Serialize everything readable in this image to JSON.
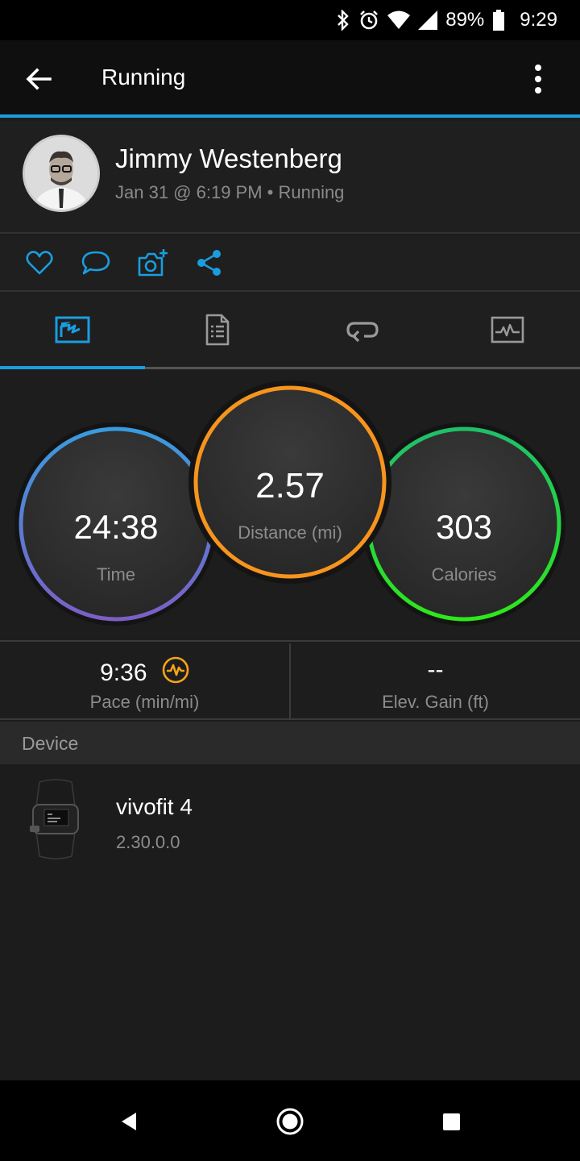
{
  "status_bar": {
    "battery": "89%",
    "time": "9:29",
    "icons": [
      "bluetooth-icon",
      "alarm-icon",
      "wifi-icon",
      "signal-icon",
      "battery-icon"
    ]
  },
  "app_bar": {
    "title": "Running",
    "back_icon": "back-arrow-icon",
    "menu_icon": "more-vert-icon"
  },
  "profile": {
    "name": "Jimmy Westenberg",
    "meta": "Jan 31 @ 6:19 PM • Running"
  },
  "actions": [
    {
      "name": "like",
      "icon": "heart-icon"
    },
    {
      "name": "comment",
      "icon": "comment-icon"
    },
    {
      "name": "add-photo",
      "icon": "camera-plus-icon"
    },
    {
      "name": "share",
      "icon": "share-icon"
    }
  ],
  "tabs": [
    {
      "name": "overview",
      "icon": "map-overview-icon",
      "active": true
    },
    {
      "name": "details",
      "icon": "document-icon",
      "active": false
    },
    {
      "name": "laps",
      "icon": "laps-icon",
      "active": false
    },
    {
      "name": "charts",
      "icon": "chart-icon",
      "active": false
    }
  ],
  "rings": {
    "time": {
      "value": "24:38",
      "label": "Time"
    },
    "distance": {
      "value": "2.57",
      "label": "Distance (mi)"
    },
    "calories": {
      "value": "303",
      "label": "Calories"
    }
  },
  "metrics": {
    "pace": {
      "value": "9:36",
      "label": "Pace (min/mi)"
    },
    "elev_gain": {
      "value": "--",
      "label": "Elev. Gain (ft)"
    }
  },
  "device": {
    "header": "Device",
    "name": "vivofit 4",
    "version": "2.30.0.0"
  },
  "colors": {
    "accent": "#1a9de0",
    "time_ring_start": "#3a9be0",
    "time_ring_end": "#7b5fc4",
    "distance_ring": "#f7941d",
    "calories_ring_start": "#1fbf6a",
    "calories_ring_end": "#2ee81a",
    "pace_icon": "#f7a21b"
  }
}
